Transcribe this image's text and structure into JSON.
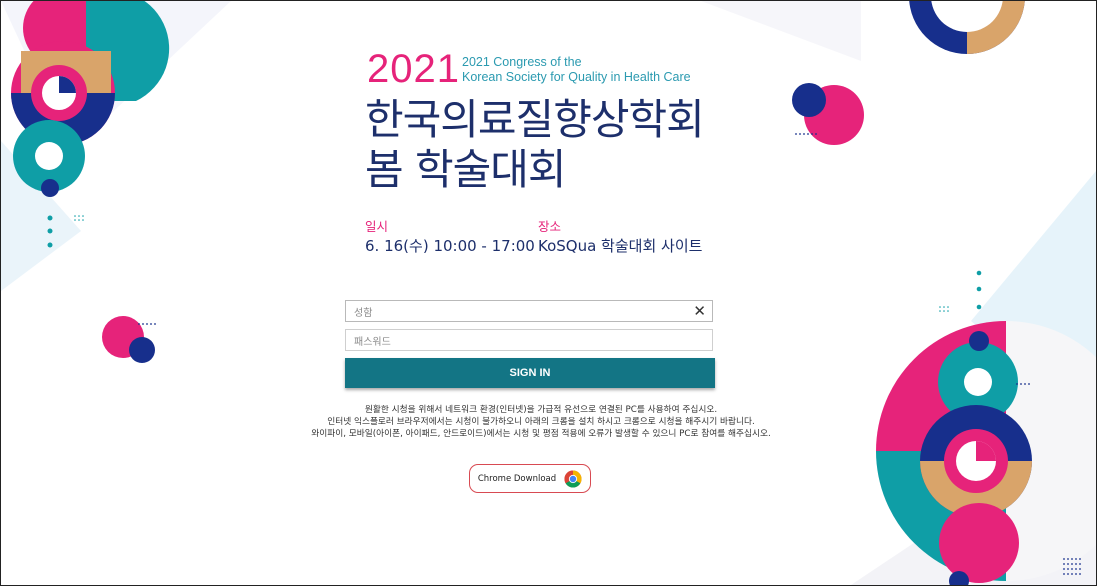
{
  "header": {
    "year": "2021",
    "congress_line1": "2021 Congress of the",
    "congress_line2": "Korean Society for Quality in Health Care",
    "title_line1": "한국의료질향상학회",
    "title_line2": "봄 학술대회"
  },
  "event": {
    "date_label": "일시",
    "date_value": "6. 16(수) 10:00 - 17:00",
    "place_label": "장소",
    "place_value": "KoSQua 학술대회 사이트"
  },
  "login": {
    "name_placeholder": "성함",
    "name_value": "",
    "password_placeholder": "패스워드",
    "password_value": "",
    "signin_label": "SIGN IN"
  },
  "notices": [
    "원활한 시청을 위해서 네트워크 환경(인터넷)을 가급적 유선으로 연결된 PC를 사용하여 주십시오.",
    "인터넷 익스플로러 브라우저에서는 시청이 불가하오니 아래의 크롬을 설치 하시고 크롬으로 시청을 해주시기 바랍니다.",
    "와이파이, 모바일(아이폰, 아이패드, 안드로이드)에서는 시청 및 평점 적용에 오류가 발생할 수 있으니 PC로 참여를 해주십시오."
  ],
  "chrome_download": {
    "label": "Chrome Download",
    "icon": "chrome-icon"
  },
  "colors": {
    "pink": "#e6237a",
    "teal": "#0f9ea6",
    "navy": "#172f8c",
    "tan": "#d9a46a",
    "button": "#137585",
    "title": "#1d2f6b"
  }
}
